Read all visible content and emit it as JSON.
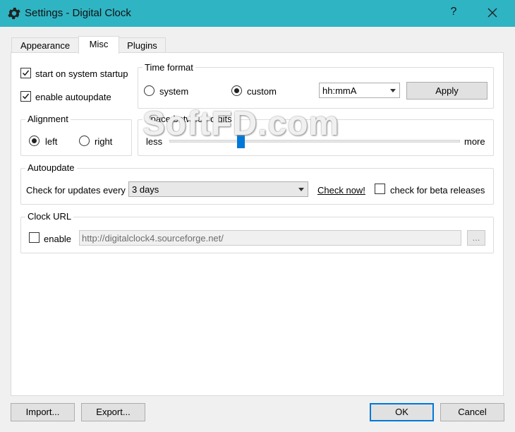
{
  "window": {
    "title": "Settings - Digital Clock",
    "help": "?"
  },
  "tabs": [
    {
      "label": "Appearance",
      "active": false
    },
    {
      "label": "Misc",
      "active": true
    },
    {
      "label": "Plugins",
      "active": false
    }
  ],
  "startup": {
    "start_label": "start on system startup",
    "start_checked": true,
    "autoupdate_label": "enable autoupdate",
    "autoupdate_checked": true
  },
  "time_format": {
    "title": "Time format",
    "system_label": "system",
    "custom_label": "custom",
    "selected": "custom",
    "format_value": "hh:mmA",
    "apply_label": "Apply"
  },
  "alignment": {
    "title": "Alignment",
    "left_label": "left",
    "right_label": "right",
    "selected": "left"
  },
  "spacing": {
    "title": "Space between digits",
    "less_label": "less",
    "more_label": "more",
    "level": 0.24
  },
  "autoupdate": {
    "title": "Autoupdate",
    "check_label": "Check for updates every",
    "interval_value": "3 days",
    "check_now_label": "Check now!",
    "beta_label": "check for beta releases",
    "beta_checked": false
  },
  "clock_url": {
    "title": "Clock URL",
    "enable_label": "enable",
    "enable_checked": false,
    "url_value": "http://digitalclock4.sourceforge.net/",
    "browse_label": "..."
  },
  "footer": {
    "import_label": "Import...",
    "export_label": "Export...",
    "ok_label": "OK",
    "cancel_label": "Cancel"
  },
  "watermark": "SoftFD.com",
  "colors": {
    "titlebar": "#2fb4c4",
    "accent": "#0078d7"
  }
}
